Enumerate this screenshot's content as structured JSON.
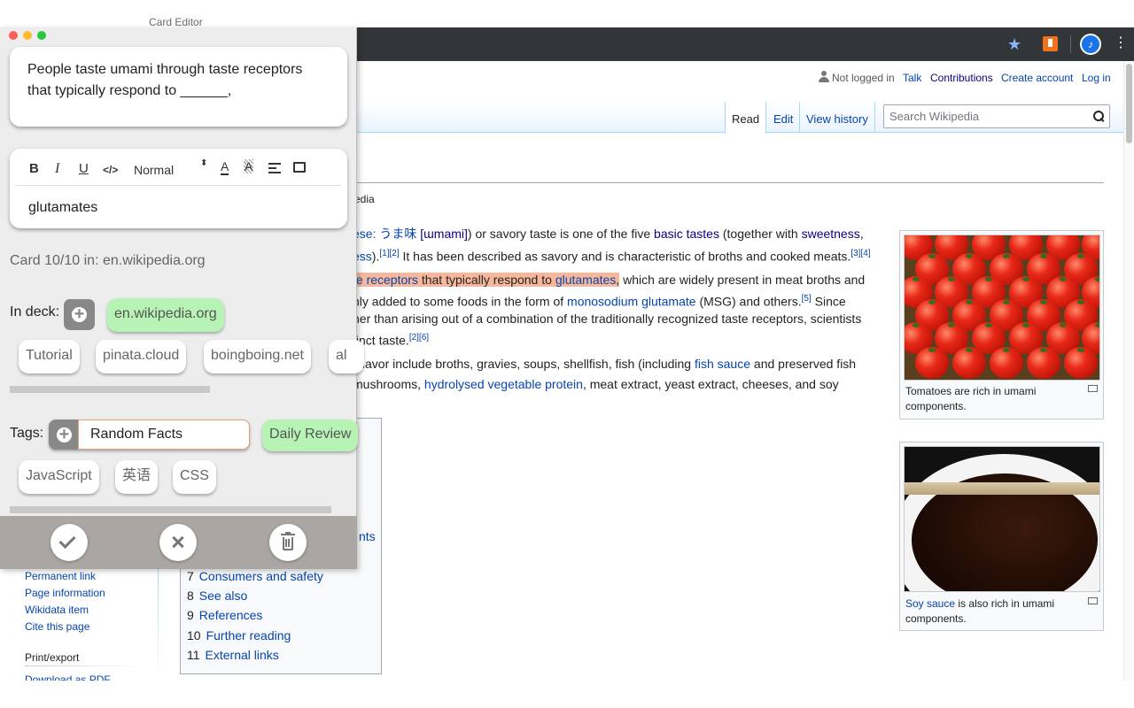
{
  "window_title": "Card Editor",
  "browser": {
    "menu_glyph": "⋮"
  },
  "wiki": {
    "personal": {
      "not_logged_in": "Not logged in",
      "talk": "Talk",
      "contributions": "Contributions",
      "create_account": "Create account",
      "log_in": "Log in"
    },
    "tabs": {
      "read": "Read",
      "edit": "Edit",
      "history": "View history"
    },
    "search": {
      "placeholder": "Search Wikipedia"
    },
    "from_fragment": "edia",
    "paragraph1": {
      "line1": {
        "a": "ese: うま味",
        "b": "[ɯmami]",
        "c": ") or savory taste is one of the five",
        "d": "basic tastes",
        "e": "(together with",
        "f": "sweetness",
        "g": ","
      },
      "line2": {
        "a": "ess",
        "b": ").",
        "sup1": "[1][2]",
        "c": "It has been described as savory and is characteristic of broths and cooked meats.",
        "sup2": "[3][4]"
      }
    },
    "paragraph2": {
      "line1": {
        "a": "te receptors",
        "b": "that typically respond to",
        "c": "glutamates",
        "d": ",",
        "e": "which are widely present in meat broths and"
      },
      "line2": {
        "a": "nly added to some foods in the form of",
        "b": "monosodium glutamate",
        "c": "(MSG) and others.",
        "sup": "[5]",
        "d": "Since"
      },
      "line3": "her than arising out of a combination of the traditionally recognized taste receptors, scientists",
      "line4": {
        "a": "tinct taste.",
        "sup": "[2][6]"
      }
    },
    "paragraph3": {
      "line1": {
        "a": "i flavor include broths, gravies, soups, shellfish, fish (including",
        "b": "fish sauce",
        "c": "and preserved fish"
      },
      "line2": {
        "a": "mushrooms,",
        "b": "hydrolysed vegetable protein",
        "c": ", meat extract, yeast extract, cheeses, and soy"
      }
    },
    "thumb1": {
      "caption": "Tomatoes are rich in umami components."
    },
    "thumb2": {
      "caption_link": "Soy sauce",
      "caption_rest": "is also rich in umami components."
    },
    "toc": {
      "partial": "nts",
      "items": [
        {
          "num": "7",
          "title": "Consumers and safety"
        },
        {
          "num": "8",
          "title": "See also"
        },
        {
          "num": "9",
          "title": "References"
        },
        {
          "num": "10",
          "title": "Further reading"
        },
        {
          "num": "11",
          "title": "External links"
        }
      ]
    },
    "sidebar": {
      "links": [
        "Permanent link",
        "Page information",
        "Wikidata item",
        "Cite this page"
      ],
      "print_heading": "Print/export",
      "download": "Download as PDF"
    }
  },
  "card_editor": {
    "question": "People taste umami through taste receptors that typically respond to ______,",
    "toolbar": {
      "bold": "B",
      "italic": "I",
      "underline": "U",
      "code": "</>",
      "size": "Normal",
      "size_arrows": "⬍",
      "color": "A",
      "background": "A"
    },
    "answer": "glutamates",
    "card_info": "Card 10/10 in: en.wikipedia.org",
    "deck_label": "In deck:",
    "current_deck": "en.wikipedia.org",
    "decks": [
      "Tutorial",
      "pinata.cloud",
      "boingboing.net",
      "al"
    ],
    "tags_label": "Tags:",
    "tag_input_value": "Random Facts",
    "tags": [
      "Daily Review",
      "JavaScript",
      "英语",
      "CSS"
    ]
  }
}
